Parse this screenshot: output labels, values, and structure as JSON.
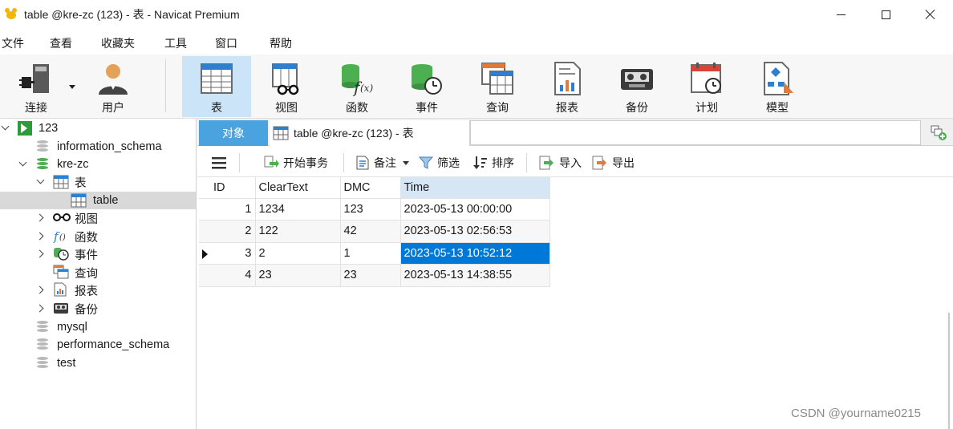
{
  "window": {
    "title": "table @kre-zc (123) - 表 - Navicat Premium"
  },
  "menu": [
    "文件",
    "查看",
    "收藏夹",
    "工具",
    "窗口",
    "帮助"
  ],
  "toolbar": {
    "buttons": [
      {
        "label": "连接",
        "icon": "plug-icon"
      },
      {
        "label": "用户",
        "icon": "user-icon"
      },
      {
        "label": "表",
        "icon": "table-icon"
      },
      {
        "label": "视图",
        "icon": "view-icon"
      },
      {
        "label": "函数",
        "icon": "function-icon"
      },
      {
        "label": "事件",
        "icon": "event-icon"
      },
      {
        "label": "查询",
        "icon": "query-icon"
      },
      {
        "label": "报表",
        "icon": "report-icon"
      },
      {
        "label": "备份",
        "icon": "backup-icon"
      },
      {
        "label": "计划",
        "icon": "schedule-icon"
      },
      {
        "label": "模型",
        "icon": "model-icon"
      }
    ],
    "active": "表"
  },
  "sidebar": {
    "connection": "123",
    "dbs": [
      "information_schema",
      "kre-zc",
      "mysql",
      "performance_schema",
      "test"
    ],
    "kre": {
      "tables_folder": "表",
      "table": "table",
      "folders": [
        "视图",
        "函数",
        "事件",
        "查询",
        "报表",
        "备份"
      ]
    }
  },
  "tabs": {
    "objects": "对象",
    "doc": "table @kre-zc (123) - 表"
  },
  "actions": {
    "begin_tx": "开始事务",
    "note": "备注",
    "filter": "筛选",
    "sort": "排序",
    "import": "导入",
    "export": "导出"
  },
  "grid": {
    "columns": [
      "ID",
      "ClearText",
      "DMC",
      "Time"
    ],
    "rows": [
      [
        "1",
        "1234",
        "123",
        "2023-05-13 00:00:00"
      ],
      [
        "2",
        "122",
        "42",
        "2023-05-13 02:56:53"
      ],
      [
        "3",
        "2",
        "1",
        "2023-05-13 10:52:12"
      ],
      [
        "4",
        "23",
        "23",
        "2023-05-13 14:38:55"
      ]
    ],
    "selected_row": 3
  },
  "watermark": "CSDN @yourname0215",
  "colors": {
    "accent": "#4aa3df",
    "selection": "#0078d7",
    "active_tool": "#cce4f7"
  }
}
